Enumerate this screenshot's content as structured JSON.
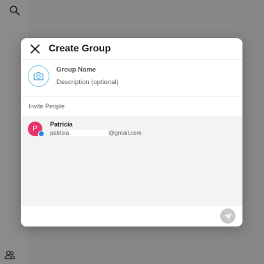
{
  "background": {
    "search_icon": "search-icon",
    "contacts_icon": "contacts-icon"
  },
  "modal": {
    "title": "Create Group",
    "close_icon": "close-icon",
    "photo_icon": "camera-icon",
    "group_name_placeholder": "Group Name",
    "description_placeholder": "Description (optional)",
    "invite_label": "Invite People",
    "people": [
      {
        "initial": "P",
        "name": "Patricia",
        "email_prefix": "patricia",
        "email_domain": "@gmail.com",
        "avatar_color": "#e8346a",
        "badge_color": "#1e88e5"
      }
    ],
    "send_icon": "send-icon"
  },
  "colors": {
    "overlay": "#878787",
    "accent": "#7ec3e8",
    "send_disabled": "#c8c8c8"
  }
}
